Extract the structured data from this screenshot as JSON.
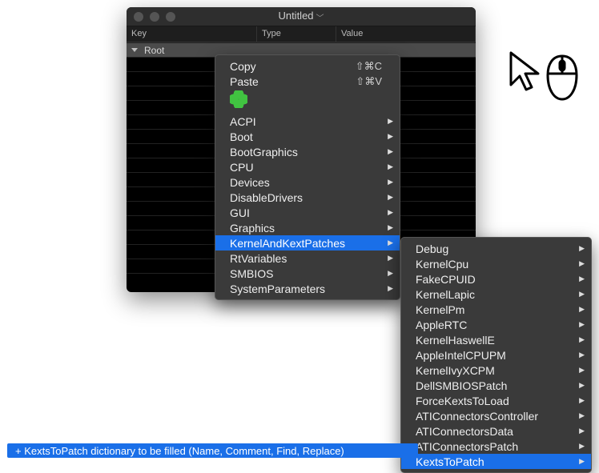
{
  "window": {
    "title": "Untitled"
  },
  "columns": {
    "key": "Key",
    "type": "Type",
    "value": "Value"
  },
  "root": {
    "key": "Root",
    "type": "",
    "value": ""
  },
  "menu1": {
    "copy": {
      "label": "Copy",
      "shortcut": "⇧⌘C"
    },
    "paste": {
      "label": "Paste",
      "shortcut": "⇧⌘V"
    },
    "items": [
      {
        "label": "ACPI"
      },
      {
        "label": "Boot"
      },
      {
        "label": "BootGraphics"
      },
      {
        "label": "CPU"
      },
      {
        "label": "Devices"
      },
      {
        "label": "DisableDrivers"
      },
      {
        "label": "GUI"
      },
      {
        "label": "Graphics"
      },
      {
        "label": "KernelAndKextPatches"
      },
      {
        "label": "RtVariables"
      },
      {
        "label": "SMBIOS"
      },
      {
        "label": "SystemParameters"
      }
    ]
  },
  "menu2": {
    "items": [
      {
        "label": "Debug"
      },
      {
        "label": "KernelCpu"
      },
      {
        "label": "FakeCPUID"
      },
      {
        "label": "KernelLapic"
      },
      {
        "label": "KernelPm"
      },
      {
        "label": "AppleRTC"
      },
      {
        "label": "KernelHaswellE"
      },
      {
        "label": "AppleIntelCPUPM"
      },
      {
        "label": "KernelIvyXCPM"
      },
      {
        "label": "DellSMBIOSPatch"
      },
      {
        "label": "ForceKextsToLoad"
      },
      {
        "label": "ATIConnectorsController"
      },
      {
        "label": "ATIConnectorsData"
      },
      {
        "label": "ATIConnectorsPatch"
      },
      {
        "label": "KextsToPatch"
      }
    ]
  },
  "status": "+ KextsToPatch dictionary to be filled (Name, Comment, Find, Replace)"
}
